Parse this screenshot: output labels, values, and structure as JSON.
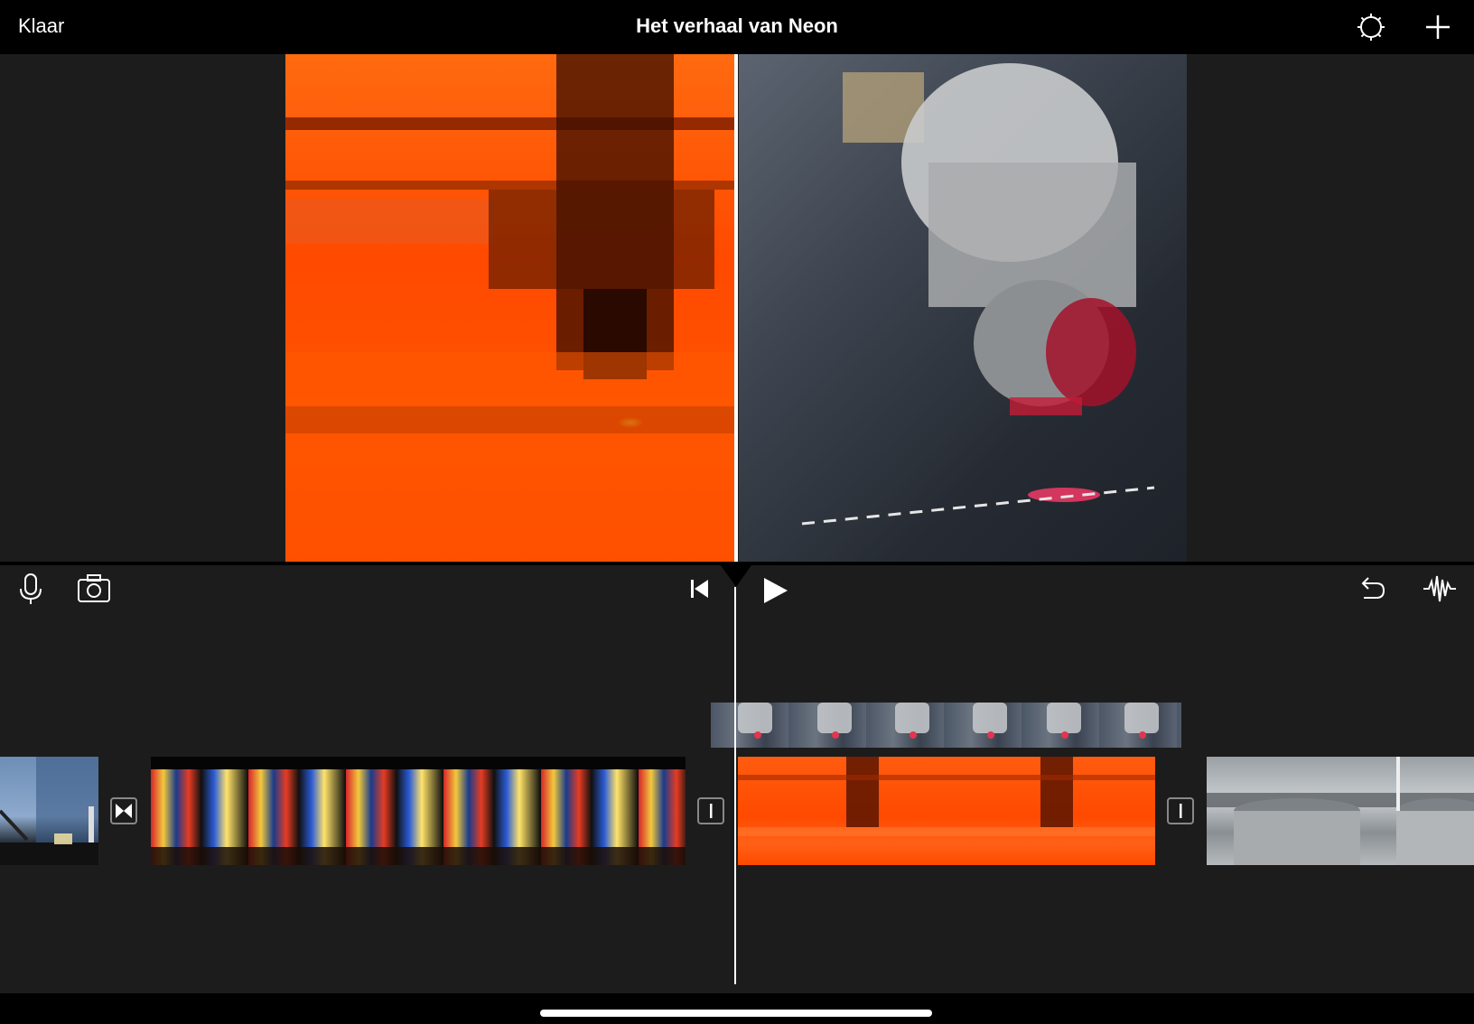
{
  "header": {
    "done_label": "Klaar",
    "title": "Het verhaal van Neon",
    "settings_icon": "gear-icon",
    "add_icon": "plus-icon"
  },
  "viewer": {
    "mode": "split-screen",
    "left_frame": "laser-cutter-orange",
    "right_frame": "laser-head-closeup"
  },
  "toolbar": {
    "left_icons": [
      "microphone-icon",
      "camera-icon"
    ],
    "center_icons": [
      "skip-to-start-icon",
      "play-icon"
    ],
    "right_icons": [
      "undo-icon",
      "audio-waveform-icon"
    ]
  },
  "timeline": {
    "clips": [
      "harbor-skyline",
      "neon-signs",
      "laser-orange",
      "metal-machine"
    ],
    "overlay_clip": "laser-head-closeup"
  },
  "colors": {
    "background": "#1c1c1c",
    "bar": "#000000",
    "accent_orange": "#ff4a00",
    "text": "#ffffff"
  }
}
